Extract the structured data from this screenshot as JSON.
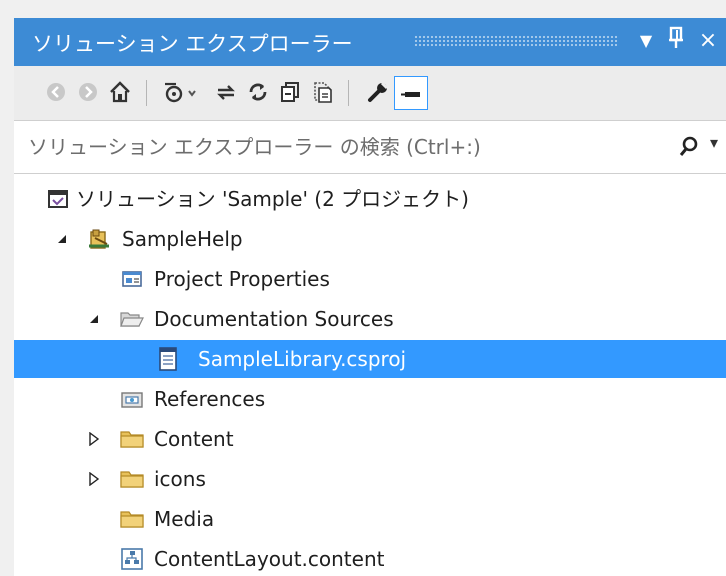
{
  "panel": {
    "title": "ソリューション エクスプローラー",
    "title_buttons": {
      "dropdown": "▼",
      "pin": "Ṗ",
      "close": "×"
    }
  },
  "toolbar": {
    "items": [
      "back-icon",
      "forward-icon",
      "home-icon",
      "pending-changes-icon",
      "sync-icon",
      "refresh-icon",
      "collapse-all-icon",
      "show-all-files-icon",
      "properties-icon",
      "preview-icon"
    ]
  },
  "search": {
    "placeholder": "ソリューション エクスプローラー の検索 (Ctrl+:)",
    "icon": "search-icon",
    "dropdown": "▾"
  },
  "tree": {
    "items": [
      {
        "label": "ソリューション 'Sample' (2 プロジェクト)",
        "icon": "solution-icon",
        "expander": "none"
      },
      {
        "label": "SampleHelp",
        "icon": "help-project-icon",
        "expander": "expanded"
      },
      {
        "label": "Project Properties",
        "icon": "properties-icon",
        "expander": "none"
      },
      {
        "label": "Documentation Sources",
        "icon": "folder-open-icon",
        "expander": "expanded"
      },
      {
        "label": "SampleLibrary.csproj",
        "icon": "csproj-file-icon",
        "expander": "none",
        "selected": true
      },
      {
        "label": "References",
        "icon": "references-icon",
        "expander": "none"
      },
      {
        "label": "Content",
        "icon": "folder-icon",
        "expander": "collapsed"
      },
      {
        "label": "icons",
        "icon": "folder-icon",
        "expander": "collapsed"
      },
      {
        "label": "Media",
        "icon": "folder-icon",
        "expander": "none"
      },
      {
        "label": "ContentLayout.content",
        "icon": "content-layout-icon",
        "expander": "none"
      }
    ]
  },
  "colors": {
    "title_bar": "#3d8bd5",
    "selection": "#3399ff",
    "folder": "#e8c15a"
  }
}
